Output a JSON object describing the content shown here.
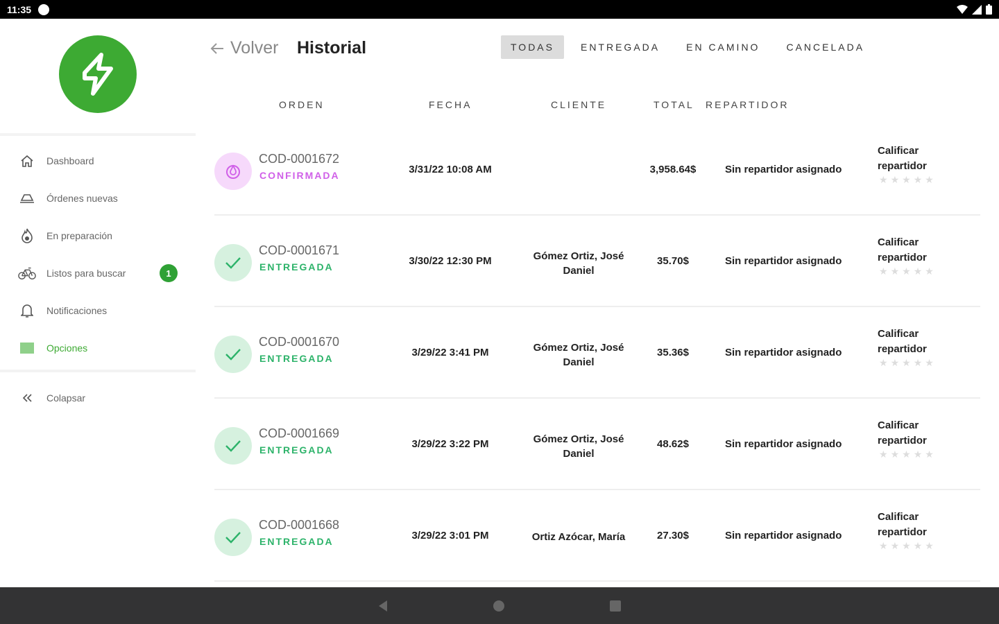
{
  "status_bar": {
    "time": "11:35"
  },
  "sidebar": {
    "items": [
      {
        "label": "Dashboard",
        "icon": "home-icon"
      },
      {
        "label": "Órdenes nuevas",
        "icon": "tray-icon"
      },
      {
        "label": "En preparación",
        "icon": "flame-icon"
      },
      {
        "label": "Listos para buscar",
        "icon": "bicycle-icon",
        "badge": "1"
      },
      {
        "label": "Notificaciones",
        "icon": "bell-icon"
      },
      {
        "label": "Opciones",
        "icon": "options-icon",
        "active": true
      }
    ],
    "collapse_label": "Colapsar"
  },
  "header": {
    "back_label": "Volver",
    "title": "Historial",
    "tabs": [
      "TODAS",
      "ENTREGADA",
      "EN CAMINO",
      "CANCELADA"
    ],
    "active_tab": "TODAS"
  },
  "table": {
    "columns": [
      "ORDEN",
      "FECHA",
      "CLIENTE",
      "TOTAL",
      "REPARTIDOR"
    ],
    "rate_label_line1": "Calificar",
    "rate_label_line2": "repartidor",
    "rows": [
      {
        "code": "COD-0001672",
        "state": "CONFIRMADA",
        "date": "3/31/22 10:08 AM",
        "client_line1": "",
        "client_line2": "",
        "total": "3,958.64$",
        "courier": "Sin repartidor asignado"
      },
      {
        "code": "COD-0001671",
        "state": "ENTREGADA",
        "date": "3/30/22 12:30 PM",
        "client_line1": "Gómez Ortiz, José",
        "client_line2": "Daniel",
        "total": "35.70$",
        "courier": "Sin repartidor asignado"
      },
      {
        "code": "COD-0001670",
        "state": "ENTREGADA",
        "date": "3/29/22 3:41 PM",
        "client_line1": "Gómez Ortiz, José",
        "client_line2": "Daniel",
        "total": "35.36$",
        "courier": "Sin repartidor asignado"
      },
      {
        "code": "COD-0001669",
        "state": "ENTREGADA",
        "date": "3/29/22 3:22 PM",
        "client_line1": "Gómez Ortiz, José",
        "client_line2": "Daniel",
        "total": "48.62$",
        "courier": "Sin repartidor asignado"
      },
      {
        "code": "COD-0001668",
        "state": "ENTREGADA",
        "date": "3/29/22 3:01 PM",
        "client_line1": "Ortiz Azócar, María",
        "client_line2": "",
        "total": "27.30$",
        "courier": "Sin repartidor asignado"
      }
    ]
  },
  "colors": {
    "brand": "#3daa33",
    "confirmed": "#d060e8",
    "confirmed_bg": "#f6d9fb",
    "delivered": "#2db36a",
    "delivered_bg": "#d6f1df"
  }
}
